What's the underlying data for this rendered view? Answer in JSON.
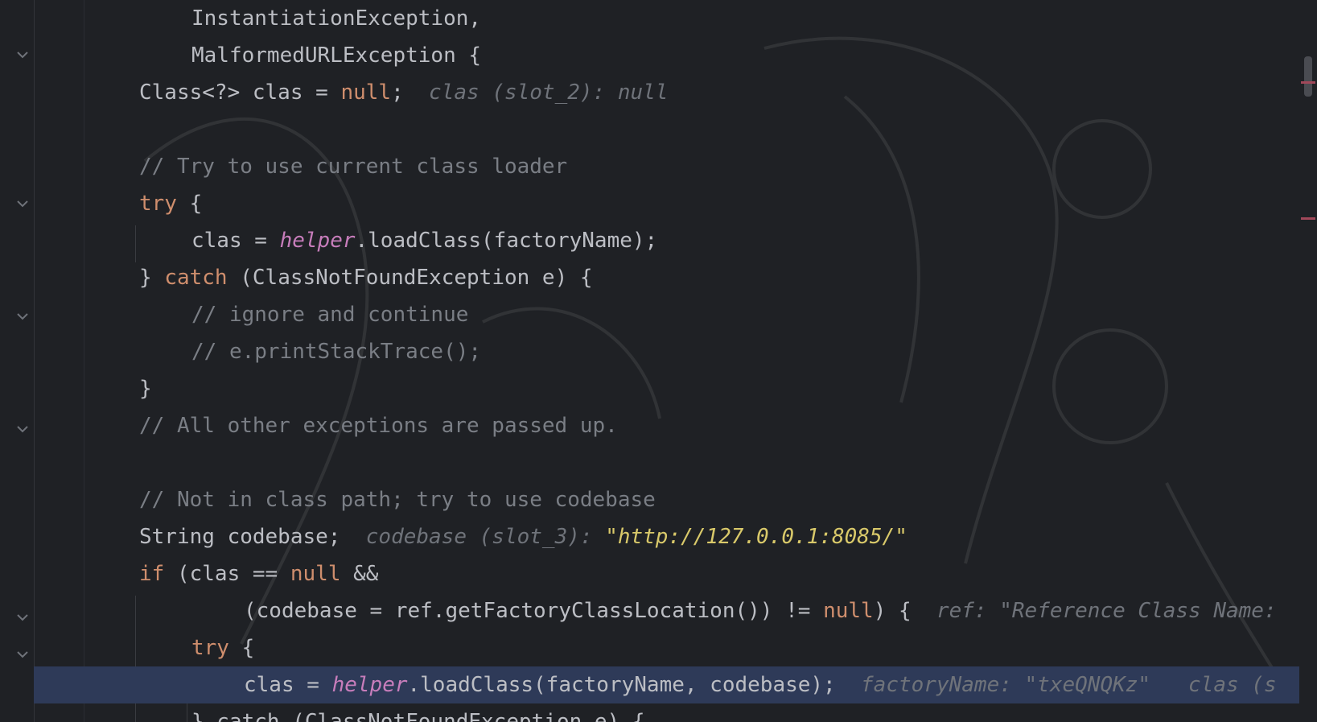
{
  "editor": {
    "lines": [
      {
        "id": "l1",
        "parts": [
          {
            "t": "InstantiationException,",
            "c": ""
          }
        ]
      },
      {
        "id": "l2",
        "parts": [
          {
            "t": "MalformedURLException {",
            "c": ""
          }
        ]
      },
      {
        "id": "l3",
        "parts": [
          {
            "t": "Class<?> clas = ",
            "c": ""
          },
          {
            "t": "null",
            "c": "kw"
          },
          {
            "t": ";  ",
            "c": ""
          },
          {
            "t": "clas (slot_2): null",
            "c": "hint"
          }
        ]
      },
      {
        "id": "l4",
        "parts": []
      },
      {
        "id": "l5",
        "parts": [
          {
            "t": "// Try to use current class loader",
            "c": "cm"
          }
        ]
      },
      {
        "id": "l6",
        "parts": [
          {
            "t": "try",
            "c": "kw"
          },
          {
            "t": " {",
            "c": ""
          }
        ]
      },
      {
        "id": "l7",
        "parts": [
          {
            "t": "clas = ",
            "c": ""
          },
          {
            "t": "helper",
            "c": "fld"
          },
          {
            "t": ".loadClass(factoryName);",
            "c": ""
          }
        ]
      },
      {
        "id": "l8",
        "parts": [
          {
            "t": "} ",
            "c": ""
          },
          {
            "t": "catch",
            "c": "kw"
          },
          {
            "t": " (ClassNotFoundException e) {",
            "c": ""
          }
        ]
      },
      {
        "id": "l9",
        "parts": [
          {
            "t": "// ignore and continue",
            "c": "cm"
          }
        ]
      },
      {
        "id": "l10",
        "parts": [
          {
            "t": "// e.printStackTrace();",
            "c": "cm"
          }
        ]
      },
      {
        "id": "l11",
        "parts": [
          {
            "t": "}",
            "c": ""
          }
        ]
      },
      {
        "id": "l12",
        "parts": [
          {
            "t": "// All other exceptions are passed up.",
            "c": "cm"
          }
        ]
      },
      {
        "id": "l13",
        "parts": []
      },
      {
        "id": "l14",
        "parts": [
          {
            "t": "// Not in class path; try to use codebase",
            "c": "cm"
          }
        ]
      },
      {
        "id": "l15",
        "parts": [
          {
            "t": "String codebase;  ",
            "c": ""
          },
          {
            "t": "codebase (slot_3): ",
            "c": "hint"
          },
          {
            "t": "\"http://127.0.0.1:8085/\"",
            "c": "str"
          }
        ]
      },
      {
        "id": "l16",
        "parts": [
          {
            "t": "if",
            "c": "kw"
          },
          {
            "t": " (clas == ",
            "c": ""
          },
          {
            "t": "null",
            "c": "kw"
          },
          {
            "t": " &&",
            "c": ""
          }
        ]
      },
      {
        "id": "l17",
        "parts": [
          {
            "t": "(codebase = ref.getFactoryClassLocation()) != ",
            "c": ""
          },
          {
            "t": "null",
            "c": "kw"
          },
          {
            "t": ") {  ",
            "c": ""
          },
          {
            "t": "ref: \"Reference Class Name:",
            "c": "hint"
          }
        ]
      },
      {
        "id": "l18",
        "parts": [
          {
            "t": "try",
            "c": "kw"
          },
          {
            "t": " {",
            "c": ""
          }
        ]
      },
      {
        "id": "l19",
        "parts": [
          {
            "t": "clas = ",
            "c": ""
          },
          {
            "t": "helper",
            "c": "fld"
          },
          {
            "t": ".loadClass(factoryName, codebase);  ",
            "c": ""
          },
          {
            "t": "factoryName: \"txeQNQKz\"   clas (s",
            "c": "hint"
          }
        ]
      },
      {
        "id": "l20",
        "parts": [
          {
            "t": "} catch (ClassNotFoundException e) {",
            "c": ""
          }
        ]
      }
    ]
  },
  "gutter": {
    "fold_icon": "chevron-down-icon"
  },
  "colors": {
    "background": "#1f2125",
    "keyword": "#cf8e6d",
    "comment": "#7a7e85",
    "field": "#c77dbb",
    "hint": "#6f737a",
    "string": "#d9c96a",
    "current_line": "#2e3a58"
  }
}
